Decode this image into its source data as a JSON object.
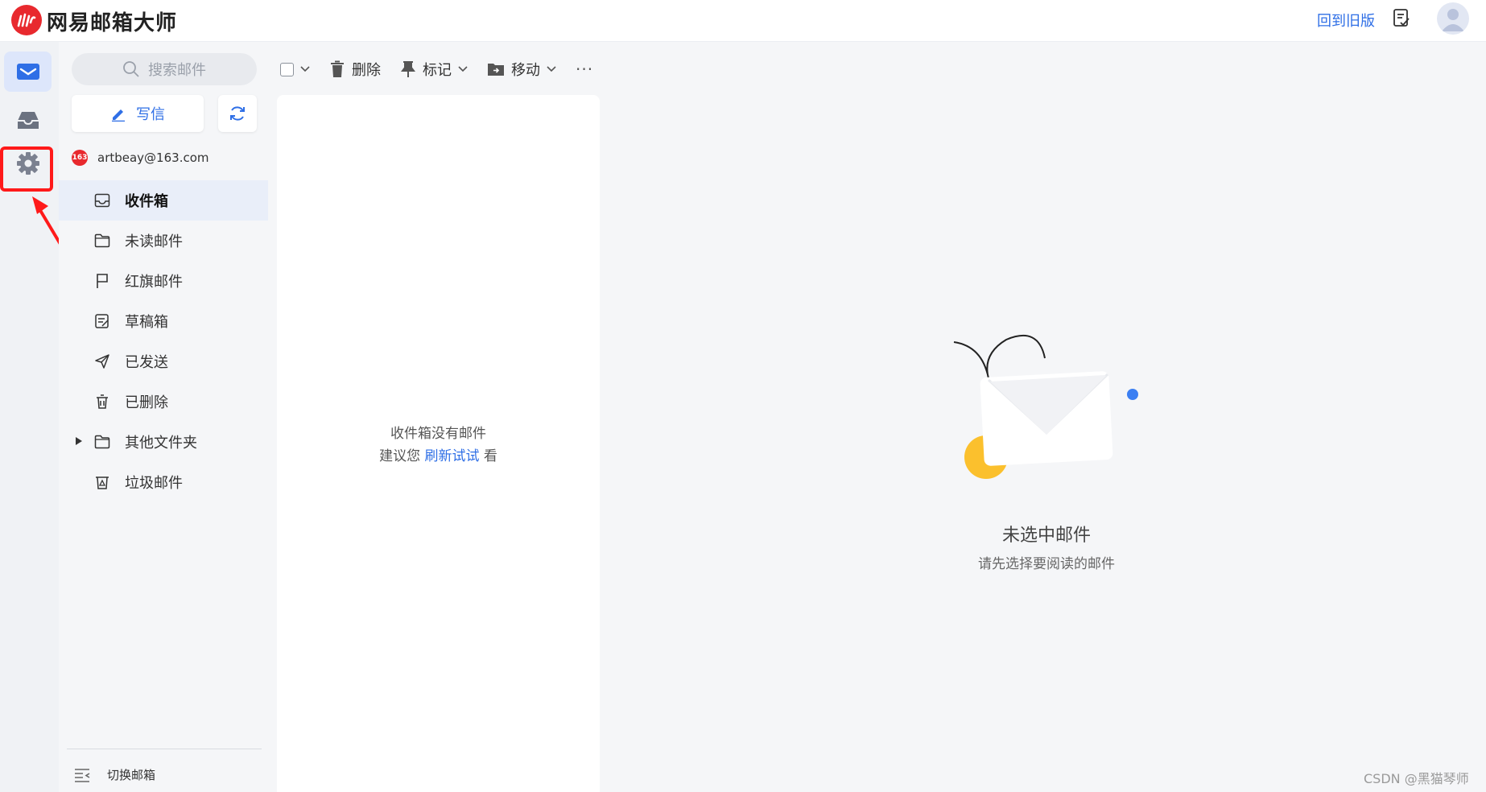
{
  "app": {
    "brand": "网易邮箱大师",
    "back_to_old": "回到旧版"
  },
  "search": {
    "placeholder": "搜索邮件"
  },
  "compose": {
    "label": "写信"
  },
  "account": {
    "badge": "163",
    "email": "artbeay@163.com"
  },
  "folders": [
    {
      "label": "收件箱",
      "icon": "inbox-icon",
      "active": true
    },
    {
      "label": "未读邮件",
      "icon": "folder-icon"
    },
    {
      "label": "红旗邮件",
      "icon": "flag-icon"
    },
    {
      "label": "草稿箱",
      "icon": "draft-icon"
    },
    {
      "label": "已发送",
      "icon": "send-icon"
    },
    {
      "label": "已删除",
      "icon": "trash-icon"
    },
    {
      "label": "其他文件夹",
      "icon": "folder-icon",
      "expandable": true
    },
    {
      "label": "垃圾邮件",
      "icon": "spam-icon"
    }
  ],
  "switch_mailbox": "切换邮箱",
  "toolbar": {
    "delete": "删除",
    "mark": "标记",
    "move": "移动",
    "more": "···"
  },
  "list_empty": {
    "line1": "收件箱没有邮件",
    "line2_prefix": "建议您 ",
    "line2_link": "刷新试试",
    "line2_suffix": " 看"
  },
  "reading_empty": {
    "title": "未选中邮件",
    "subtitle": "请先选择要阅读的邮件"
  },
  "watermark": "CSDN @黑猫琴师",
  "colors": {
    "accent": "#2f6fe6",
    "brand_red": "#e8292e",
    "annotation_red": "#ff1a1a",
    "yellow": "#fbc02d"
  }
}
